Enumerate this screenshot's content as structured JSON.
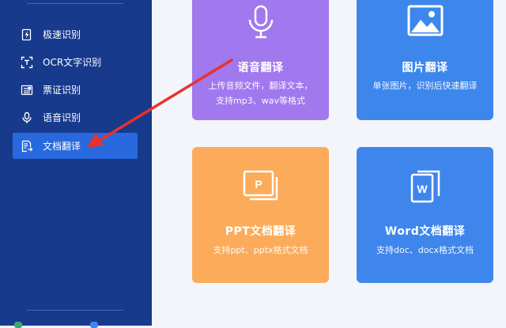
{
  "sidebar": {
    "items": [
      {
        "label": "极速识别",
        "icon": "bolt-document-icon"
      },
      {
        "label": "OCR文字识别",
        "icon": "scan-frame-icon"
      },
      {
        "label": "票证识别",
        "icon": "ticket-icon"
      },
      {
        "label": "语音识别",
        "icon": "microphone-icon"
      },
      {
        "label": "文档翻译",
        "icon": "document-translate-icon",
        "active": true
      }
    ]
  },
  "cards": {
    "speech": {
      "title": "语音翻译",
      "desc_line1": "上传音频文件，翻译文本，",
      "desc_line2": "支持mp3、wav等格式",
      "icon": "microphone-icon",
      "color": "#a178ee"
    },
    "image": {
      "title": "图片翻译",
      "desc_line1": "单张图片，识别后快速翻译",
      "icon": "image-icon",
      "color": "#3d86ec"
    },
    "ppt": {
      "title": "PPT文档翻译",
      "desc_line1": "支持ppt、pptx格式文档",
      "icon": "ppt-file-icon",
      "icon_letter": "P",
      "color": "#fbab5a"
    },
    "word": {
      "title": "Word文档翻译",
      "desc_line1": "支持doc、docx格式文档",
      "icon": "word-file-icon",
      "icon_letter": "W",
      "color": "#3f86ec"
    }
  },
  "colors": {
    "sidebar_bg": "#173a8c",
    "active_item": "#2869dd",
    "annotation_arrow": "#e8322c"
  }
}
